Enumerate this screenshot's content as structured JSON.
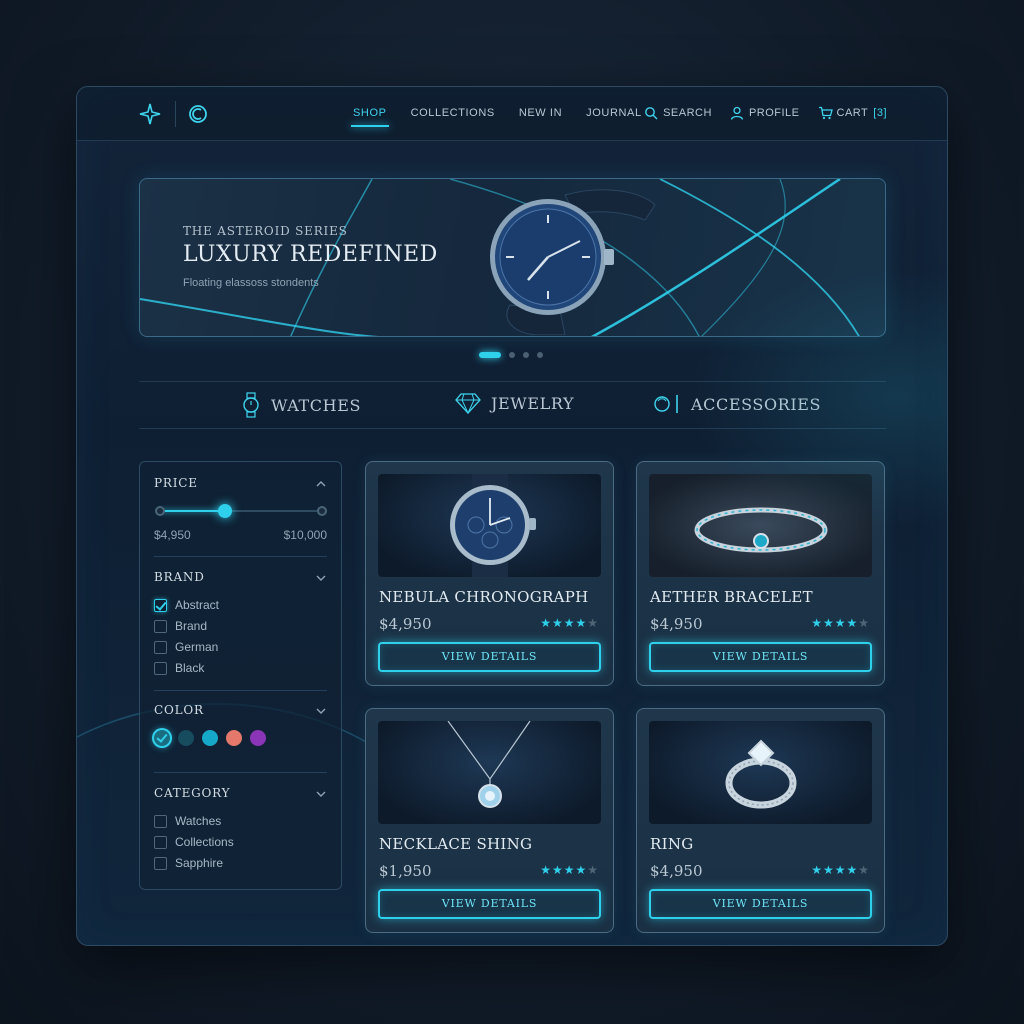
{
  "nav": {
    "links": [
      "SHOP",
      "COLLECTIONS",
      "NEW IN",
      "JOURNAL"
    ],
    "active": "SHOP",
    "search_label": "SEARCH",
    "profile_label": "PROFILE",
    "cart_label": "CART",
    "cart_count": "[3]"
  },
  "hero": {
    "kicker": "THE ASTEROID SERIES",
    "title": "LUXURY REDEFINED",
    "subtitle": "Floating elassoss stondents",
    "slide_count": 4,
    "active_slide": 1
  },
  "categories": [
    "WATCHES",
    "JEWELRY",
    "ACCESSORIES"
  ],
  "filters": {
    "price": {
      "title": "PRICE",
      "min_label": "$4,950",
      "max_label": "$10,000"
    },
    "brand": {
      "title": "BRAND",
      "options": [
        {
          "label": "Abstract",
          "checked": true
        },
        {
          "label": "Brand",
          "checked": false
        },
        {
          "label": "German",
          "checked": false
        },
        {
          "label": "Black",
          "checked": false
        }
      ]
    },
    "color": {
      "title": "COLOR",
      "swatches": [
        "#1a6d80",
        "#174b5e",
        "#16a8c8",
        "#e4786a",
        "#8a35b8"
      ],
      "selected": 0
    },
    "category": {
      "title": "CATEGORY",
      "options": [
        {
          "label": "Watches",
          "checked": false
        },
        {
          "label": "Collections",
          "checked": false
        },
        {
          "label": "Sapphire",
          "checked": false
        }
      ]
    }
  },
  "products": [
    {
      "name": "NEBULA CHRONOGRAPH",
      "price": "$4,950",
      "rating": 4.5,
      "cta": "VIEW DETAILS",
      "image": "watch"
    },
    {
      "name": "AETHER BRACELET",
      "price": "$4,950",
      "rating": 4,
      "cta": "VIEW DETAILS",
      "image": "bracelet"
    },
    {
      "name": "NECKLACE SHING",
      "price": "$1,950",
      "rating": 4.5,
      "cta": "VIEW DETAILS",
      "image": "necklace"
    },
    {
      "name": "RING",
      "price": "$4,950",
      "rating": 4,
      "cta": "VIEW DETAILS",
      "image": "ring"
    }
  ],
  "colors": {
    "accent": "#2fd0ec",
    "background": "#101a27",
    "panel": "#13243a"
  }
}
